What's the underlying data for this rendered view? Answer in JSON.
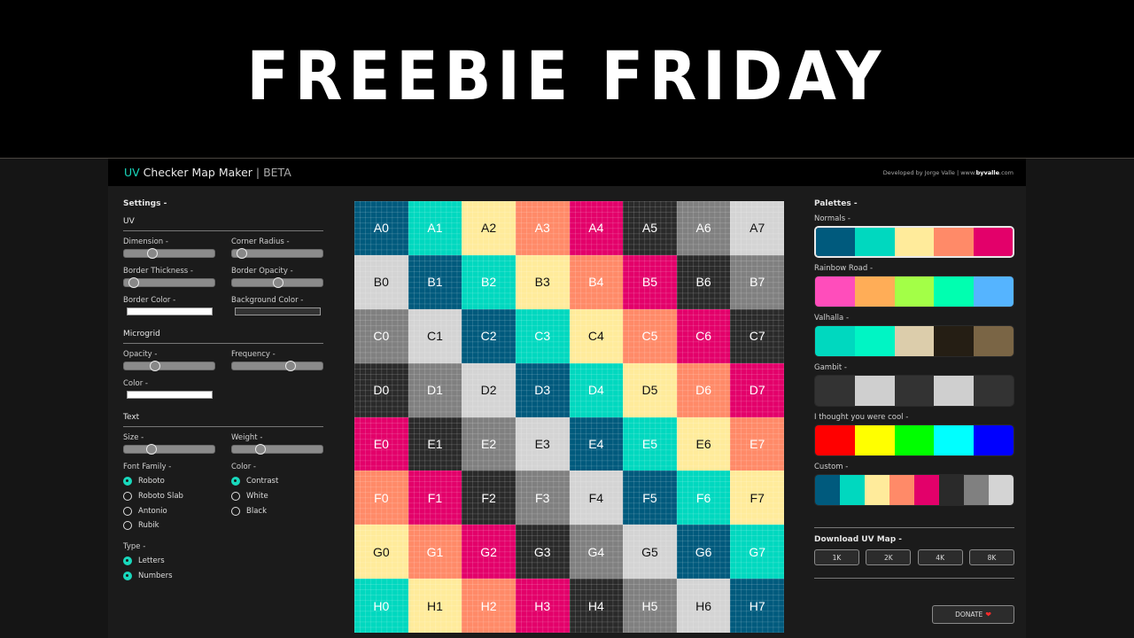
{
  "banner": {
    "title": "FREEBIE FRIDAY"
  },
  "app": {
    "title_accent": "UV",
    "title_main": " Checker Map Maker",
    "title_suffix": " | BETA",
    "credit_prefix": "Developed by Jorge Valle | www.",
    "credit_bold": "byvalle",
    "credit_suffix": ".com",
    "accent_color": "#19d9bd"
  },
  "settings": {
    "heading": "Settings -",
    "uv": {
      "title": "UV",
      "dimension": {
        "label": "Dimension -",
        "value": 0.28
      },
      "corner_radius": {
        "label": "Corner Radius -",
        "value": 0.05
      },
      "border_thickness": {
        "label": "Border Thickness -",
        "value": 0.05
      },
      "border_opacity": {
        "label": "Border Opacity -",
        "value": 0.5
      },
      "border_color": {
        "label": "Border Color -",
        "value": "#ffffff"
      },
      "background_color": {
        "label": "Background Color -",
        "value": "#333333"
      }
    },
    "microgrid": {
      "title": "Microgrid",
      "opacity": {
        "label": "Opacity -",
        "value": 0.32
      },
      "frequency": {
        "label": "Frequency -",
        "value": 0.65
      },
      "color": {
        "label": "Color -",
        "value": "#ffffff"
      }
    },
    "text": {
      "title": "Text",
      "size": {
        "label": "Size -",
        "value": 0.27
      },
      "weight": {
        "label": "Weight -",
        "value": 0.28
      },
      "font_family": {
        "label": "Font Family -",
        "options": [
          "Roboto",
          "Roboto Slab",
          "Antonio",
          "Rubik"
        ],
        "selected": "Roboto"
      },
      "color": {
        "label": "Color -",
        "options": [
          "Contrast",
          "White",
          "Black"
        ],
        "selected": "Contrast"
      },
      "type": {
        "label": "Type -",
        "options": [
          "Letters",
          "Numbers"
        ],
        "checked": [
          "Letters",
          "Numbers"
        ]
      }
    }
  },
  "uv_grid": {
    "rows": [
      "A",
      "B",
      "C",
      "D",
      "E",
      "F",
      "G",
      "H"
    ],
    "colors": {
      "N": "#005a7d",
      "T": "#00d8bf",
      "Y": "#ffeb9b",
      "S": "#ff8a68",
      "M": "#e3006a",
      "D": "#2a2a2a",
      "G": "#808080",
      "L": "#d4d4d4"
    },
    "pattern": [
      [
        "N",
        "T",
        "Y",
        "S",
        "M",
        "D",
        "G",
        "L"
      ],
      [
        "L",
        "N",
        "T",
        "Y",
        "S",
        "M",
        "D",
        "G"
      ],
      [
        "G",
        "L",
        "N",
        "T",
        "Y",
        "S",
        "M",
        "D"
      ],
      [
        "D",
        "G",
        "L",
        "N",
        "T",
        "Y",
        "S",
        "M"
      ],
      [
        "M",
        "D",
        "G",
        "L",
        "N",
        "T",
        "Y",
        "S"
      ],
      [
        "S",
        "M",
        "D",
        "G",
        "L",
        "N",
        "T",
        "Y"
      ],
      [
        "Y",
        "S",
        "M",
        "D",
        "G",
        "L",
        "N",
        "T"
      ],
      [
        "T",
        "Y",
        "S",
        "M",
        "D",
        "G",
        "L",
        "N"
      ]
    ],
    "dark_text_colors": [
      "Y",
      "L"
    ]
  },
  "palettes": {
    "heading": "Palettes -",
    "items": [
      {
        "name": "Normals -",
        "selected": true,
        "colors": [
          "#005a7d",
          "#00d8bf",
          "#ffeb9b",
          "#ff8a68",
          "#e3006a"
        ]
      },
      {
        "name": "Rainbow Road -",
        "selected": false,
        "colors": [
          "#ff4dbb",
          "#ffad57",
          "#a3ff47",
          "#00ffb0",
          "#55b4ff"
        ]
      },
      {
        "name": "Valhalla -",
        "selected": false,
        "colors": [
          "#00d8bf",
          "#00f5c4",
          "#dccdab",
          "#251e14",
          "#7a6545"
        ]
      },
      {
        "name": "Gambit -",
        "selected": false,
        "colors": [
          "#333333",
          "#cfcfcf",
          "#333333",
          "#cfcfcf",
          "#333333"
        ]
      },
      {
        "name": "I thought you were cool -",
        "selected": false,
        "colors": [
          "#ff0000",
          "#ffff00",
          "#00ff00",
          "#00ffff",
          "#0000ff"
        ]
      },
      {
        "name": "Custom -",
        "selected": false,
        "colors": [
          "#005a7d",
          "#00d8bf",
          "#ffeb9b",
          "#ff8a68",
          "#e3006a",
          "#2a2a2a",
          "#808080",
          "#d4d4d4"
        ]
      }
    ]
  },
  "download": {
    "title": "Download UV Map -",
    "buttons": [
      "1K",
      "2K",
      "4K",
      "8K"
    ]
  },
  "donate": {
    "label": "DONATE",
    "icon": "heart-icon",
    "icon_glyph": "❤"
  }
}
